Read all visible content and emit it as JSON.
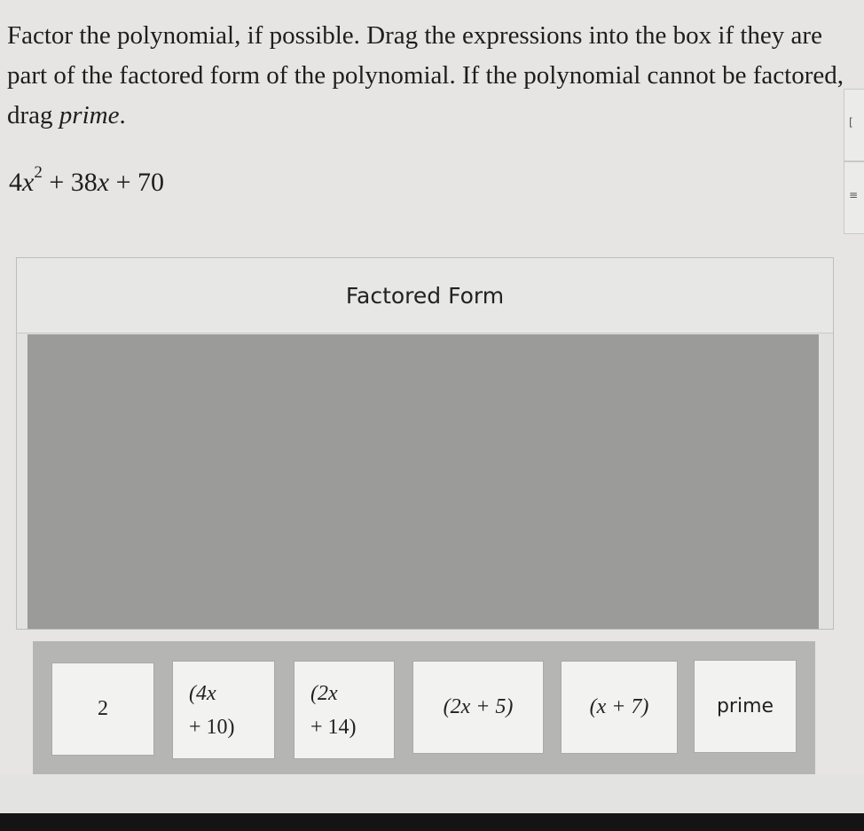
{
  "question": {
    "text": "Factor the polynomial, if possible. Drag the expressions into the box if they are part of the factored form of the polynomial. If the polynomial cannot be factored, drag ",
    "emph": "prime",
    "end": "."
  },
  "polynomial": {
    "coef1": "4",
    "var1": "x",
    "exp": "2",
    "op1": " + ",
    "coef2": "38",
    "var2": "x",
    "op2": " + ",
    "const": "70"
  },
  "panel": {
    "title": "Factored Form"
  },
  "tiles": [
    {
      "id": "two",
      "line1": "2"
    },
    {
      "id": "4x-plus-10",
      "line1": "(4x",
      "line2": "+ 10)"
    },
    {
      "id": "2x-plus-14",
      "line1": "(2x",
      "line2": "+ 14)"
    },
    {
      "id": "2x-plus-5",
      "line1": "(2x + 5)"
    },
    {
      "id": "x-plus-7",
      "line1": "(x + 7)"
    },
    {
      "id": "prime",
      "line1": "prime"
    }
  ],
  "colors": {
    "drop_zone": "#9b9b99",
    "tray": "#b5b5b3",
    "tile": "#f2f2f0"
  }
}
